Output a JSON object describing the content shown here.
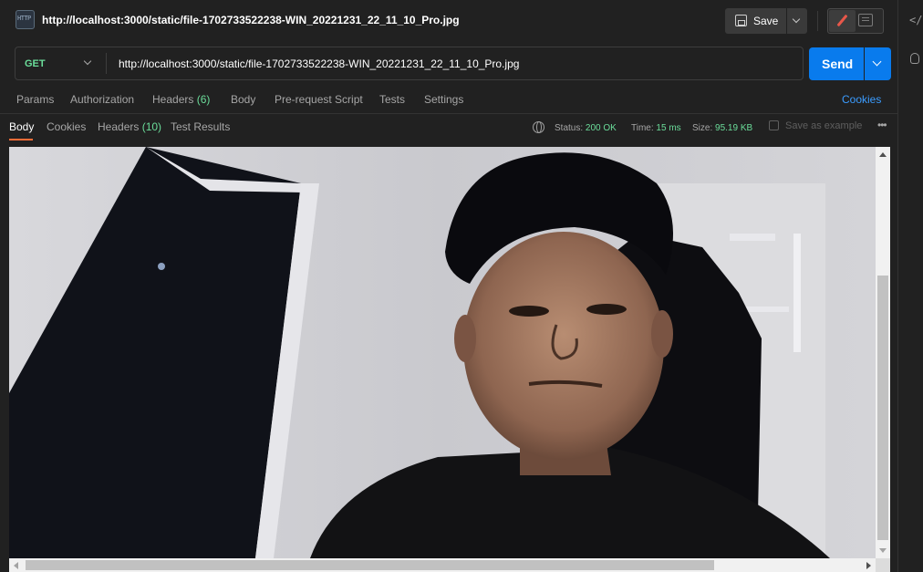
{
  "titlebar": {
    "badge": "HTTP",
    "title": "http://localhost:3000/static/file-1702733522238-WIN_20221231_22_11_10_Pro.jpg",
    "save_label": "Save"
  },
  "request": {
    "method": "GET",
    "url": "http://localhost:3000/static/file-1702733522238-WIN_20221231_22_11_10_Pro.jpg",
    "send_label": "Send"
  },
  "request_tabs": {
    "params": "Params",
    "authorization": "Authorization",
    "headers": "Headers",
    "headers_count": "(6)",
    "body": "Body",
    "prerequest": "Pre-request Script",
    "tests": "Tests",
    "settings": "Settings",
    "cookies": "Cookies"
  },
  "response_tabs": {
    "body": "Body",
    "cookies": "Cookies",
    "headers": "Headers",
    "headers_count": "(10)",
    "test_results": "Test Results"
  },
  "response_meta": {
    "status_label": "Status:",
    "status_value": "200 OK",
    "time_label": "Time:",
    "time_value": "15 ms",
    "size_label": "Size:",
    "size_value": "95.19 KB",
    "save_example": "Save as example"
  },
  "colors": {
    "accent_orange": "#ff6c37",
    "send_blue": "#097bed",
    "success_green": "#6bdd9a",
    "link_blue": "#3b9cff"
  }
}
